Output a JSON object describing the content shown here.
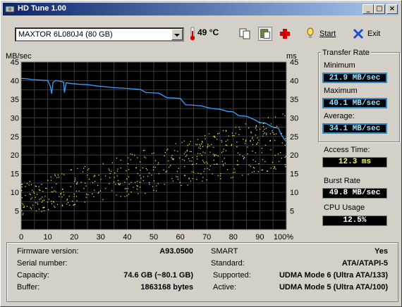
{
  "window": {
    "title": "HD Tune 1.00"
  },
  "toolbar": {
    "drive_selected": "MAXTOR 6L080J4 (80 GB)",
    "temperature": "49 °C",
    "start_label": "Start",
    "exit_label": "Exit"
  },
  "chart_data": {
    "type": "line",
    "y_left_label": "MB/sec",
    "y_right_label": "ms",
    "ylim": [
      0,
      45
    ],
    "y_ticks": [
      "5",
      "10",
      "15",
      "20",
      "25",
      "30",
      "35",
      "40",
      "45"
    ],
    "x_ticks": [
      "0",
      "10",
      "20",
      "30",
      "40",
      "50",
      "60",
      "70",
      "80",
      "90",
      "100%"
    ],
    "grid": true,
    "series": [
      {
        "name": "Transfer Rate",
        "color": "#3aa0ff",
        "x": [
          0,
          2,
          4,
          6,
          8,
          10,
          11,
          11.5,
          12,
          13,
          15,
          16,
          16.3,
          17,
          19,
          22,
          25,
          28,
          32,
          35,
          40,
          45,
          47,
          50,
          52,
          55,
          58,
          60,
          62,
          65,
          68,
          70,
          72,
          75,
          78,
          80,
          82,
          85,
          88,
          90,
          92,
          95,
          97,
          98,
          99,
          100
        ],
        "y": [
          40.6,
          40.5,
          40.3,
          40.2,
          40.1,
          40.0,
          38.5,
          36.5,
          39.5,
          40,
          39.8,
          39.6,
          36.8,
          39.4,
          39.2,
          39,
          38.9,
          38.6,
          38.3,
          38.1,
          37.9,
          37.6,
          36.8,
          36.7,
          36.6,
          35.4,
          35.3,
          35.2,
          33.5,
          33.4,
          33.2,
          32.8,
          32.5,
          32.3,
          31.7,
          31.6,
          30.6,
          30.4,
          29.5,
          28.7,
          28.6,
          27.5,
          27.2,
          25.6,
          24.5,
          23.6
        ]
      },
      {
        "name": "Access Time",
        "color": "#ffff60",
        "kind": "scatter",
        "trend": {
          "x0": 0,
          "y0": 8.5,
          "x1": 100,
          "y1": 24
        }
      }
    ]
  },
  "transfer_rate": {
    "group_label": "Transfer Rate",
    "minimum_label": "Minimum",
    "minimum_value": "21.9 MB/sec",
    "maximum_label": "Maximum",
    "maximum_value": "40.1 MB/sec",
    "average_label": "Average:",
    "average_value": "34.1 MB/sec"
  },
  "access_time": {
    "label": "Access Time:",
    "value": "12.3 ms"
  },
  "burst_rate": {
    "label": "Burst Rate",
    "value": "49.8 MB/sec"
  },
  "cpu_usage": {
    "label": "CPU Usage",
    "value": "12.5%"
  },
  "info": {
    "firmware_label": "Firmware version:",
    "firmware_value": "A93.0500",
    "serial_label": "Serial number:",
    "serial_value": "",
    "capacity_label": "Capacity:",
    "capacity_value": "74.6 GB (~80.1 GB)",
    "buffer_label": "Buffer:",
    "buffer_value": "1863168 bytes",
    "smart_label": "SMART",
    "smart_value": "Yes",
    "standard_label": "Standard:",
    "standard_value": "ATA/ATAPI-5",
    "supported_label": "Supported:",
    "supported_value": "UDMA Mode 6 (Ultra ATA/133)",
    "active_label": "Active:",
    "active_value": "UDMA Mode 5 (Ultra ATA/100)"
  }
}
